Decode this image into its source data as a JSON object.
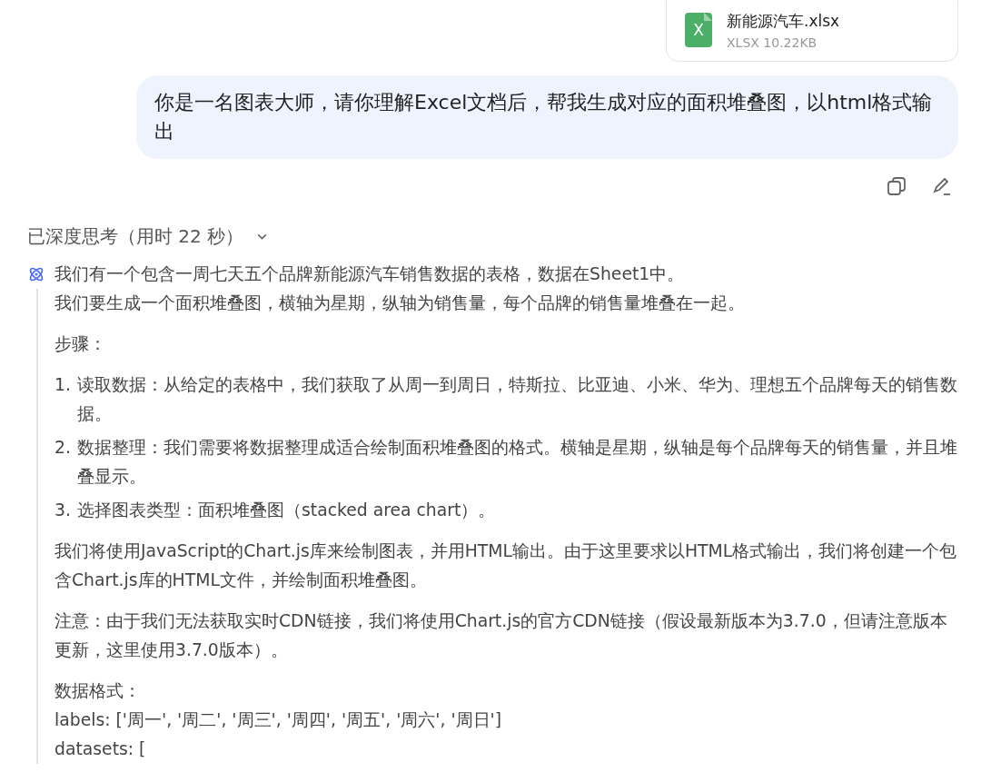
{
  "attachment": {
    "name": "新能源汽车.xlsx",
    "meta": "XLSX 10.22KB",
    "badge": "X"
  },
  "user_message": "你是一名图表大师，请你理解Excel文档后，帮我生成对应的面积堆叠图，以html格式输出",
  "thinking": {
    "header": "已深度思考（用时 22 秒）",
    "expanded": true,
    "lead": "我们有一个包含一周七天五个品牌新能源汽车销售数据的表格，数据在Sheet1中。",
    "blocks": [
      {
        "kind": "lines",
        "lines": [
          "我们要生成一个面积堆叠图，横轴为星期，纵轴为销售量，每个品牌的销售量堆叠在一起。"
        ]
      },
      {
        "kind": "lines",
        "lines": [
          "步骤："
        ]
      },
      {
        "kind": "list",
        "items": [
          {
            "number": "1.",
            "text": "读取数据：从给定的表格中，我们获取了从周一到周日，特斯拉、比亚迪、小米、华为、理想五个品牌每天的销售数据。"
          },
          {
            "number": "2.",
            "text": "数据整理：我们需要将数据整理成适合绘制面积堆叠图的格式。横轴是星期，纵轴是每个品牌每天的销售量，并且堆叠显示。"
          },
          {
            "number": "3.",
            "text": "选择图表类型：面积堆叠图（stacked area chart）。"
          }
        ]
      },
      {
        "kind": "lines",
        "lines": [
          "我们将使用JavaScript的Chart.js库来绘制图表，并用HTML输出。由于这里要求以HTML格式输出，我们将创建一个包含Chart.js库的HTML文件，并绘制面积堆叠图。"
        ]
      },
      {
        "kind": "lines",
        "lines": [
          "注意：由于我们无法获取实时CDN链接，我们将使用Chart.js的官方CDN链接（假设最新版本为3.7.0，但请注意版本更新，这里使用3.7.0版本）。"
        ]
      },
      {
        "kind": "lines",
        "lines": [
          "数据格式：",
          "labels: ['周一', '周二', '周三', '周四', '周五', '周六', '周日']",
          "datasets: ["
        ]
      }
    ]
  }
}
